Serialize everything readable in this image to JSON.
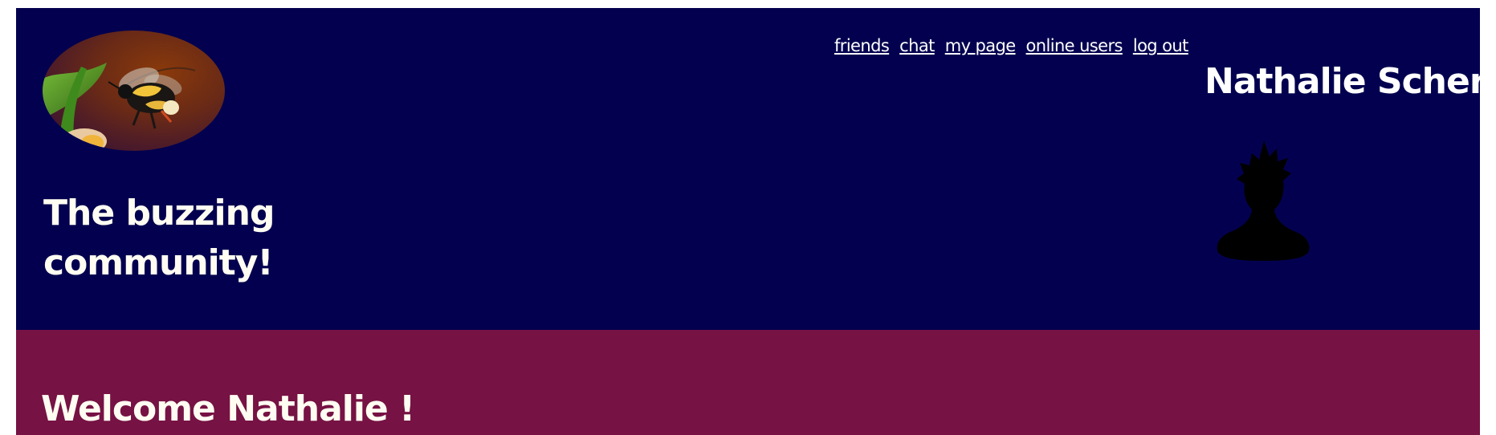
{
  "site": {
    "tagline": "The buzzing community!",
    "logo_icon": "bumblebee-photo"
  },
  "nav": {
    "items": [
      {
        "label": "friends"
      },
      {
        "label": "chat"
      },
      {
        "label": "my page"
      },
      {
        "label": "online users"
      },
      {
        "label": "log out"
      }
    ]
  },
  "profile": {
    "name": "Nathalie Scherf",
    "avatar_icon": "user-silhouette-avatar"
  },
  "main": {
    "welcome": "Welcome Nathalie !"
  },
  "colors": {
    "header_bg": "#03014f",
    "welcome_bg": "#761244",
    "text": "#ffffff"
  }
}
